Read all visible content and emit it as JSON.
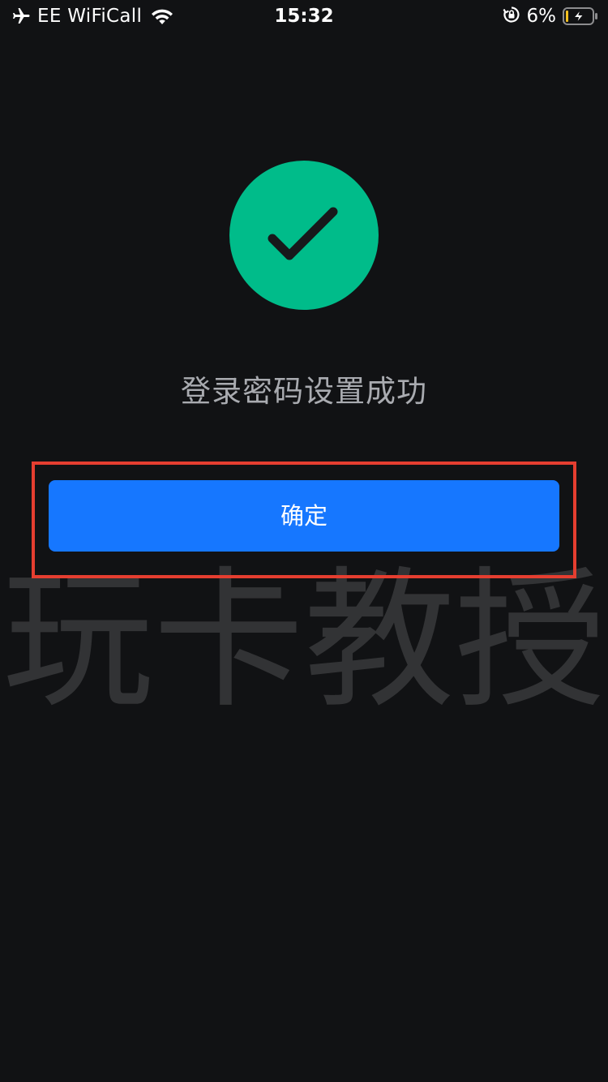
{
  "status_bar": {
    "carrier": "EE WiFiCall",
    "time": "15:32",
    "battery_percent": "6%",
    "icons": [
      "airplane-icon",
      "wifi-icon",
      "rotation-lock-icon",
      "battery-charging-icon"
    ]
  },
  "result": {
    "icon": "checkmark-icon",
    "message": "登录密码设置成功"
  },
  "confirm_button": {
    "label": "确定"
  },
  "watermark": {
    "text": "玩卡教授"
  },
  "colors": {
    "background": "#111214",
    "success": "#00bc8a",
    "primary_button": "#1677ff",
    "highlight": "#e53e30",
    "message_text": "#a9abb0"
  }
}
